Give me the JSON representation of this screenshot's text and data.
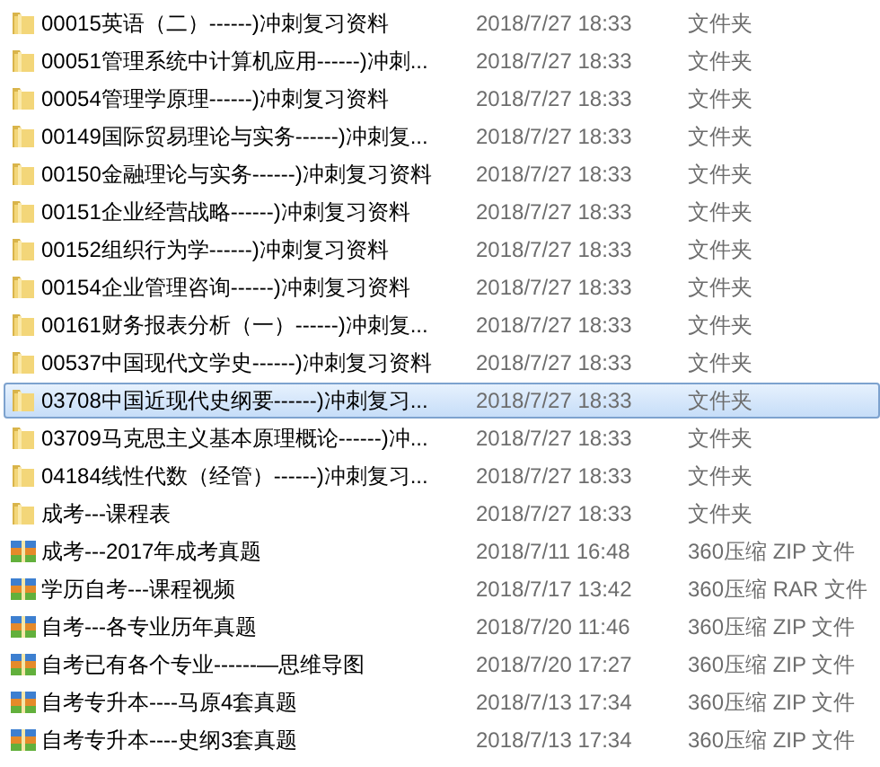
{
  "files": [
    {
      "kind": "folder",
      "name": "00015英语（二）------)冲刺复习资料",
      "modified": "2018/7/27 18:33",
      "type": "文件夹",
      "selected": false
    },
    {
      "kind": "folder",
      "name": "00051管理系统中计算机应用------)冲刺...",
      "modified": "2018/7/27 18:33",
      "type": "文件夹",
      "selected": false
    },
    {
      "kind": "folder",
      "name": "00054管理学原理------)冲刺复习资料",
      "modified": "2018/7/27 18:33",
      "type": "文件夹",
      "selected": false
    },
    {
      "kind": "folder",
      "name": "00149国际贸易理论与实务------)冲刺复...",
      "modified": "2018/7/27 18:33",
      "type": "文件夹",
      "selected": false
    },
    {
      "kind": "folder",
      "name": "00150金融理论与实务------)冲刺复习资料",
      "modified": "2018/7/27 18:33",
      "type": "文件夹",
      "selected": false
    },
    {
      "kind": "folder",
      "name": "00151企业经营战略------)冲刺复习资料",
      "modified": "2018/7/27 18:33",
      "type": "文件夹",
      "selected": false
    },
    {
      "kind": "folder",
      "name": "00152组织行为学------)冲刺复习资料",
      "modified": "2018/7/27 18:33",
      "type": "文件夹",
      "selected": false
    },
    {
      "kind": "folder",
      "name": "00154企业管理咨询------)冲刺复习资料",
      "modified": "2018/7/27 18:33",
      "type": "文件夹",
      "selected": false
    },
    {
      "kind": "folder",
      "name": "00161财务报表分析（一）------)冲刺复...",
      "modified": "2018/7/27 18:33",
      "type": "文件夹",
      "selected": false
    },
    {
      "kind": "folder",
      "name": "00537中国现代文学史------)冲刺复习资料",
      "modified": "2018/7/27 18:33",
      "type": "文件夹",
      "selected": false
    },
    {
      "kind": "folder",
      "name": "03708中国近现代史纲要------)冲刺复习...",
      "modified": "2018/7/27 18:33",
      "type": "文件夹",
      "selected": true
    },
    {
      "kind": "folder",
      "name": "03709马克思主义基本原理概论------)冲...",
      "modified": "2018/7/27 18:33",
      "type": "文件夹",
      "selected": false
    },
    {
      "kind": "folder",
      "name": "04184线性代数（经管）------)冲刺复习...",
      "modified": "2018/7/27 18:33",
      "type": "文件夹",
      "selected": false
    },
    {
      "kind": "folder",
      "name": "成考---课程表",
      "modified": "2018/7/27 18:33",
      "type": "文件夹",
      "selected": false
    },
    {
      "kind": "archive",
      "name": "成考---2017年成考真题",
      "modified": "2018/7/11 16:48",
      "type": "360压缩 ZIP 文件",
      "selected": false
    },
    {
      "kind": "archive",
      "name": "学历自考---课程视频",
      "modified": "2018/7/17 13:42",
      "type": "360压缩 RAR 文件",
      "selected": false
    },
    {
      "kind": "archive",
      "name": "自考---各专业历年真题",
      "modified": "2018/7/20 11:46",
      "type": "360压缩 ZIP 文件",
      "selected": false
    },
    {
      "kind": "archive",
      "name": "自考已有各个专业------—思维导图",
      "modified": "2018/7/20 17:27",
      "type": "360压缩 ZIP 文件",
      "selected": false
    },
    {
      "kind": "archive",
      "name": "自考专升本----马原4套真题",
      "modified": "2018/7/13 17:34",
      "type": "360压缩 ZIP 文件",
      "selected": false
    },
    {
      "kind": "archive",
      "name": "自考专升本----史纲3套真题",
      "modified": "2018/7/13 17:34",
      "type": "360压缩 ZIP 文件",
      "selected": false
    }
  ]
}
